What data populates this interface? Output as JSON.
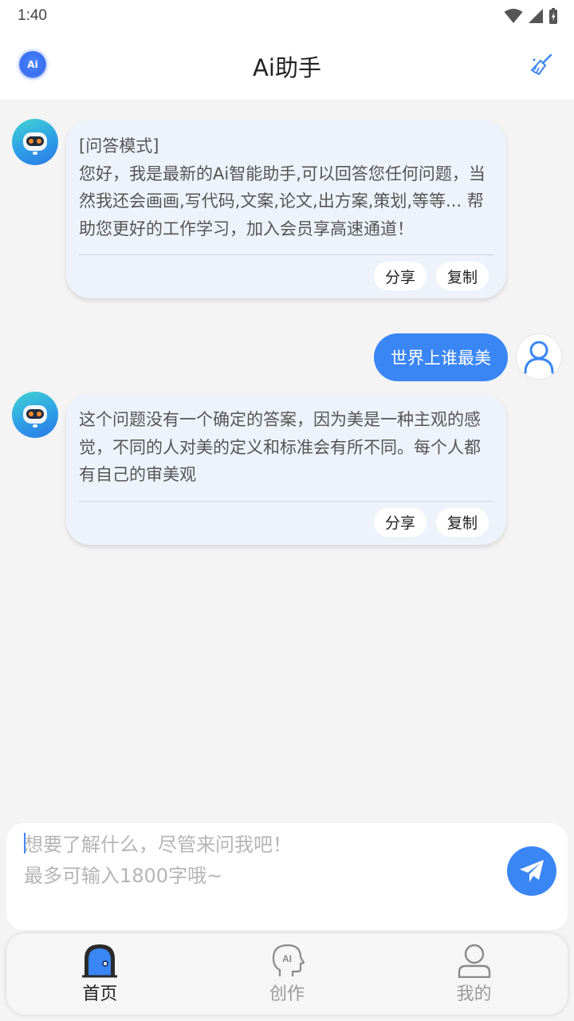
{
  "status_bar": {
    "time": "1:40"
  },
  "header": {
    "logo_text": "Ai",
    "title": "Ai助手"
  },
  "messages": [
    {
      "role": "assistant",
      "text": "[问答模式]\n您好，我是最新的Ai智能助手,可以回答您任何问题，当然我还会画画,写代码,文案,论文,出方案,策划,等等... 帮助您更好的工作学习，加入会员享高速通道！",
      "share_label": "分享",
      "copy_label": "复制"
    },
    {
      "role": "user",
      "text": "世界上谁最美"
    },
    {
      "role": "assistant",
      "text": "这个问题没有一个确定的答案，因为美是一种主观的感觉，不同的人对美的定义和标准会有所不同。每个人都有自己的审美观",
      "share_label": "分享",
      "copy_label": "复制"
    }
  ],
  "composer": {
    "placeholder": "想要了解什么，尽管来问我吧！\n最多可输入1800字哦~"
  },
  "tabs": [
    {
      "label": "首页",
      "icon": "home-icon",
      "active": true
    },
    {
      "label": "创作",
      "icon": "ai-head-icon",
      "active": false
    },
    {
      "label": "我的",
      "icon": "profile-icon",
      "active": false
    }
  ],
  "colors": {
    "accent": "#3a86f5",
    "bubble": "#eef3fb",
    "background": "#f4f4f5"
  }
}
